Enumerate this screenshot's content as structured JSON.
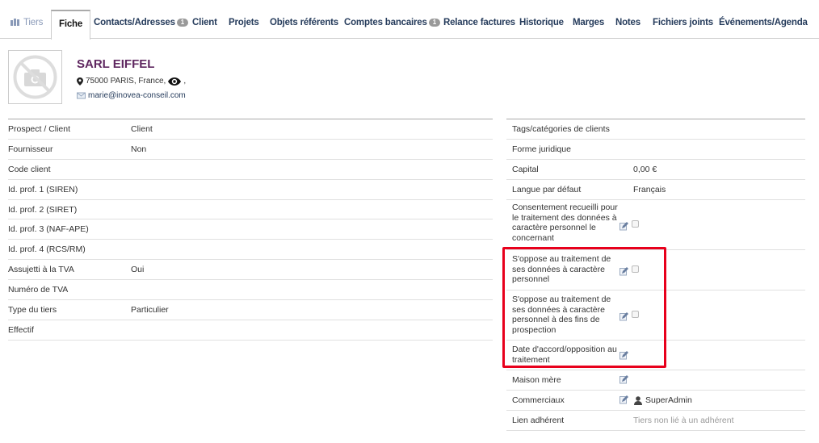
{
  "tabs": [
    {
      "label": "Tiers",
      "badge": null
    },
    {
      "label": "Fiche",
      "badge": null
    },
    {
      "label": "Contacts/Adresses",
      "badge": "1"
    },
    {
      "label": "Client",
      "badge": null
    },
    {
      "label": "Projets",
      "badge": null
    },
    {
      "label": "Objets référents",
      "badge": null
    },
    {
      "label": "Comptes bancaires",
      "badge": "1"
    },
    {
      "label": "Relance factures",
      "badge": null
    },
    {
      "label": "Historique",
      "badge": null
    },
    {
      "label": "Marges",
      "badge": null
    },
    {
      "label": "Notes",
      "badge": null
    },
    {
      "label": "Fichiers joints",
      "badge": null
    },
    {
      "label": "Événements/Agenda",
      "badge": null
    }
  ],
  "header": {
    "name": "SARL EIFFEL",
    "address": "75000 PARIS, France,",
    "address_suffix": ",",
    "email": "marie@inovea-conseil.com"
  },
  "left_fields": [
    {
      "label": "Prospect / Client",
      "value": "Client"
    },
    {
      "label": "Fournisseur",
      "value": "Non"
    },
    {
      "label": "Code client",
      "value": ""
    },
    {
      "label": "Id. prof. 1 (SIREN)",
      "value": ""
    },
    {
      "label": "Id. prof. 2 (SIRET)",
      "value": ""
    },
    {
      "label": "Id. prof. 3 (NAF-APE)",
      "value": ""
    },
    {
      "label": "Id. prof. 4 (RCS/RM)",
      "value": ""
    },
    {
      "label": "Assujetti à la TVA",
      "value": "Oui"
    },
    {
      "label": "Numéro de TVA",
      "value": ""
    },
    {
      "label": "Type du tiers",
      "value": "Particulier"
    },
    {
      "label": "Effectif",
      "value": ""
    }
  ],
  "right_fields": {
    "tags": {
      "label": "Tags/catégories de clients"
    },
    "forme": {
      "label": "Forme juridique"
    },
    "capital": {
      "label": "Capital",
      "value": "0,00 €"
    },
    "langue": {
      "label": "Langue par défaut",
      "value": "Français"
    },
    "consent": {
      "label": "Consentement recueilli pour le traitement des données à caractère personnel le concernant"
    },
    "oppose1": {
      "label": "S'oppose au traitement de ses données à caractère personnel"
    },
    "oppose2": {
      "label": "S'oppose au traitement de ses données à caractère personnel à des fins de prospection"
    },
    "date_accord": {
      "label": "Date d'accord/opposition au traitement"
    },
    "maison": {
      "label": "Maison mère"
    },
    "commerciaux": {
      "label": "Commerciaux",
      "value": "SuperAdmin"
    },
    "lien": {
      "label": "Lien adhérent",
      "value": "Tiers non lié à un adhérent"
    }
  },
  "colors": {
    "highlight": "#e8001c",
    "company": "#5f2760",
    "tab": "#263c5c"
  }
}
